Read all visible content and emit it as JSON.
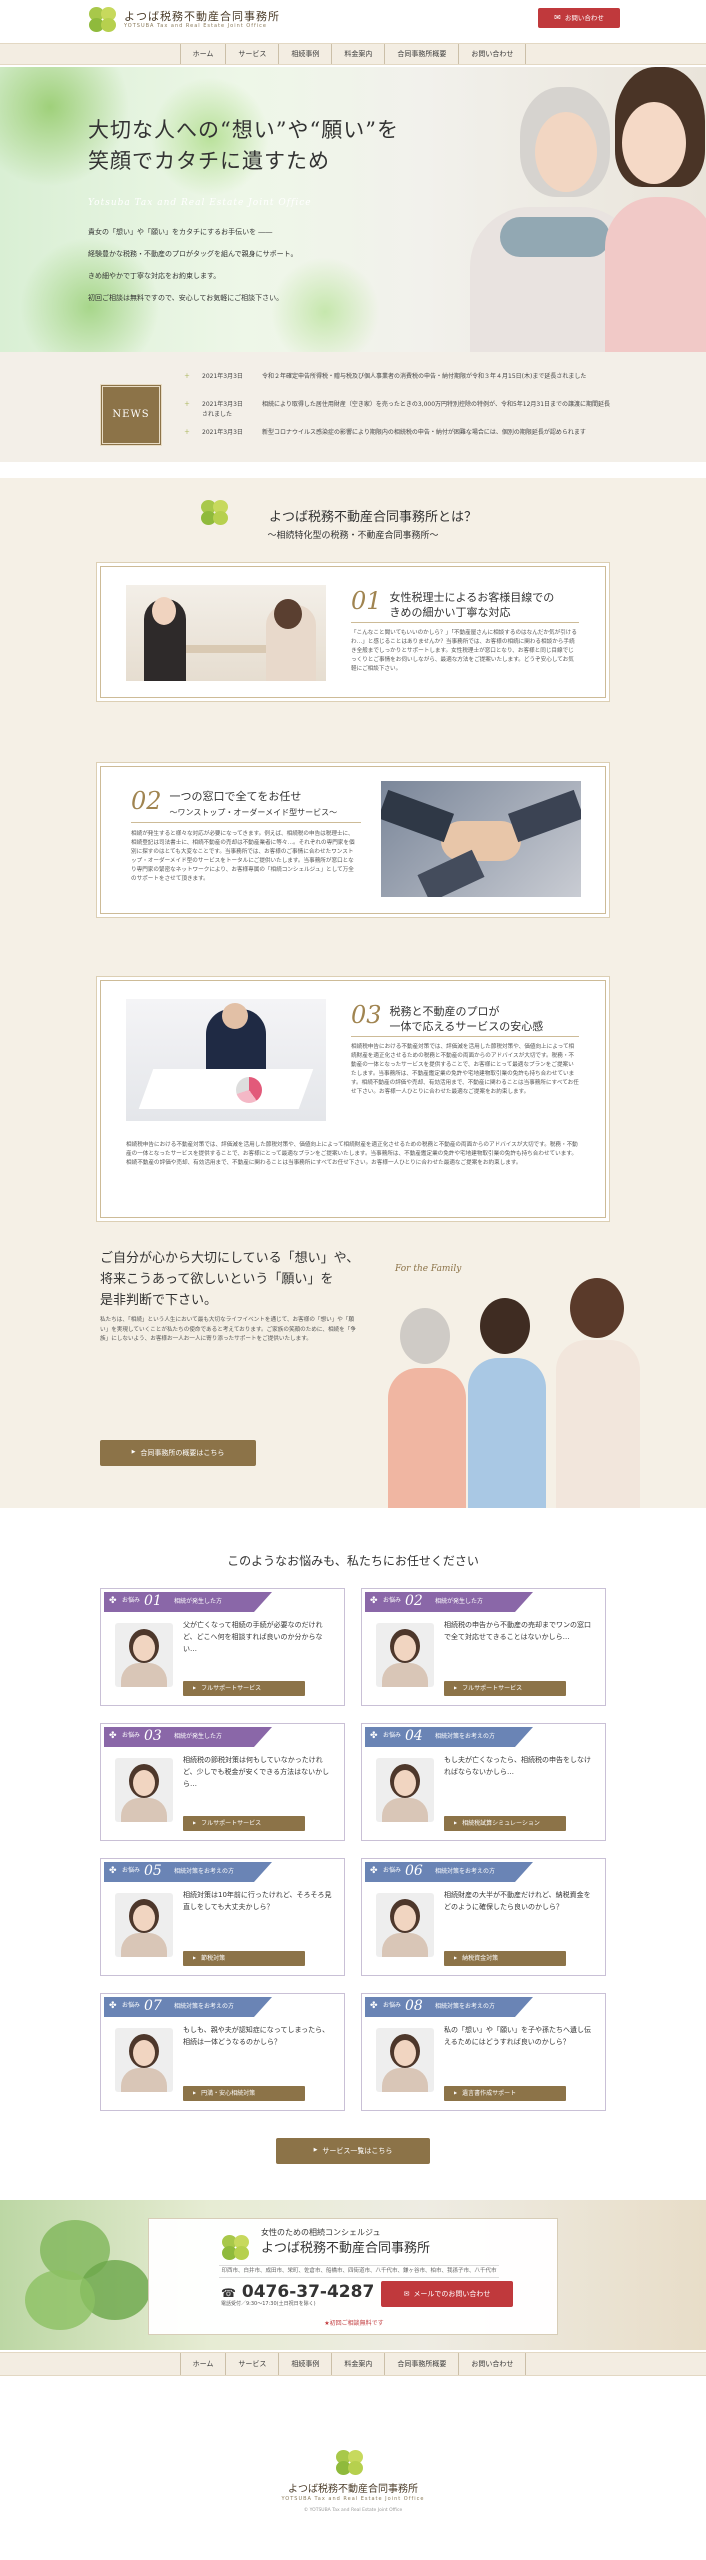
{
  "header": {
    "logo_title": "よつば税務不動産合同事務所",
    "logo_sub": "YOTSUBA Tax and Real Estate Joint Office",
    "contact_btn": "お問い合わせ"
  },
  "nav": [
    "ホーム",
    "サービス",
    "相続事例",
    "料金案内",
    "合同事務所概要",
    "お問い合わせ"
  ],
  "hero": {
    "title_line1": "大切な人への“想い”や“願い”を",
    "title_line2": "笑顔でカタチに遺すため",
    "en": "Yotsuba Tax and Real Estate Joint Office",
    "line1": "貴女の「想い」や「願い」をカタチにするお手伝いを ――",
    "line2": "経験豊かな税務・不動産のプロがタッグを組んで親身にサポート。",
    "line3": "きめ細やかで丁寧な対応をお約束します。",
    "line4": "初回ご相談は無料ですので、安心してお気軽にご相談下さい。"
  },
  "news": {
    "label": "NEWS",
    "items": [
      {
        "date": "2021年3月3日",
        "text": "令和２年確定申告所得税・贈与税及び個人事業者の消費税の申告・納付期限が令和３年４月15日(木)まで延長されました"
      },
      {
        "date": "2021年3月3日",
        "text": "相続により取得した居住用財産（空き家）を売ったときの3,000万円特別控除の特例が、令和5年12月31日までの譲渡に期間延長されました"
      },
      {
        "date": "2021年3月3日",
        "text": "新型コロナウイルス感染症の影響により期限内の相続税の申告・納付が困難な場合には、個別の期限延長が認められます"
      }
    ]
  },
  "about": {
    "title": "よつば税務不動産合同事務所とは？",
    "subtitle": "〜相続特化型の税務・不動産合同事務所〜",
    "cards": [
      {
        "num": "01",
        "heading1": "女性税理士によるお客様目線での",
        "heading2": "きめの細かい丁寧な対応",
        "text": "「こんなこと聞いてもいいのかしら？」「不動産屋さんに相談するのはなんだか気が引けるわ…」と感じることはありませんか？当事務所では、お客様の相続に関わる相談から手続き全般までしっかりとサポートします。女性税理士が窓口となり、お客様と同じ目線でじっくりとご事情をお伺いしながら、最適な方法をご提案いたします。どうぞ安心してお気軽にご相談下さい。"
      },
      {
        "num": "02",
        "heading1": "一つの窓口で全てをお任せ",
        "heading2": "〜ワンストップ・オーダーメイド型サービス〜",
        "text": "相続が発生すると様々な対応が必要になってきます。例えば、相続税の申告は税理士に、相続登記は司法書士に、相続不動産の売却は不動産業者に等々…。それぞれの専門家を個別に探すのはとても大変なことです。当事務所では、お客様のご事情に合わせたワンストップ・オーダーメイド型のサービスをトータルにご提供いたします。当事務所が窓口となり専門家の緊密なネットワークにより、お客様専属の「相続コンシェルジュ」として万全のサポートをさせて頂きます。"
      },
      {
        "num": "03",
        "heading1": "税務と不動産のプロが",
        "heading2": "一体で応えるサービスの安心感",
        "text": "相続税申告における不動産対策では、評価減を活用した節税対策や、価値向上によって相続財産を適正化させるための税務と不動産の両面からのアドバイスが大切です。税務・不動産の一体となったサービスを提供することで、お客様にとって最適なプランをご提案いたします。当事務所は、不動産鑑定業の免許や宅地建物取引業の免許も持ち合わせています。相続不動産の評価や売却、有効活用まで、不動産に関わることは当事務所にすべてお任せ下さい。お客様一人ひとりに合わせた最適なご提案をお約束します。"
      }
    ],
    "feel_title1": "ご自分が心から大切にしている「想い」や、",
    "feel_title2": "将来こうあって欲しいという「願い」を",
    "feel_title3": "是非判断で下さい。",
    "feel_text": "私たちは、「相続」という人生において最も大切なライフイベントを通じて、お客様の「想い」や「願い」を実現していくことが私たちの使命であると考えております。ご家族の笑顔のために、相続を「争族」にしないよう、お客様お一人お一人に寄り添ったサポートをご提供いたします。",
    "feel_en": "For the Family",
    "feel_btn": "合同事務所の概要はこちら"
  },
  "worries": {
    "title": "このようなお悩みも、私たちにお任せください",
    "prefix": "お悩み",
    "cards": [
      {
        "n": "01",
        "cat": "相続が発生した方",
        "text": "父が亡くなって相続の手続が必要なのだけれど、どこへ何を相談すれば良いのか分からない…",
        "btn": "フルサポートサービス",
        "color": "#8a67a8"
      },
      {
        "n": "02",
        "cat": "相続が発生した方",
        "text": "相続税の申告から不動産の売却までワンの窓口で全て対応せてきることはないかしら…",
        "btn": "フルサポートサービス",
        "color": "#8a67a8"
      },
      {
        "n": "03",
        "cat": "相続が発生した方",
        "text": "相続税の節税対策は何もしていなかったけれど、少しでも税金が安くできる方法はないかしら…",
        "btn": "フルサポートサービス",
        "color": "#8a67a8"
      },
      {
        "n": "04",
        "cat": "相続対策をお考えの方",
        "text": "もし夫が亡くなったら、相続税の申告をしなければならないかしら…",
        "btn": "相続税試算シミュレーション",
        "color": "#6a84b5"
      },
      {
        "n": "05",
        "cat": "相続対策をお考えの方",
        "text": "相続対策は10年前に行ったけれど、そろそろ見直しをしても大丈夫かしら？",
        "btn": "節税対策",
        "color": "#6a84b5"
      },
      {
        "n": "06",
        "cat": "相続対策をお考えの方",
        "text": "相続財産の大半が不動産だけれど、納税資金をどのように確保したら良いのかしら？",
        "btn": "納税資金対策",
        "color": "#6a84b5"
      },
      {
        "n": "07",
        "cat": "相続対策をお考えの方",
        "text": "もしも、親や夫が認知症になってしまったら、相続は一体どうなるのかしら？",
        "btn": "円満・安心相続対策",
        "color": "#6a84b5"
      },
      {
        "n": "08",
        "cat": "相続対策をお考えの方",
        "text": "私の「想い」や「願い」を子や孫たちへ遺し伝えるためにはどうすれば良いのかしら？",
        "btn": "遺言書作成サポート",
        "color": "#6a84b5"
      }
    ],
    "more_btn": "サービス一覧はこちら"
  },
  "concierge": {
    "tagline": "女性のための相続コンシェルジュ",
    "name": "よつば税務不動産合同事務所",
    "areas": "印西市、白井市、成田市、栄町、佐倉市、船橋市、四街道市、八千代市、鎌ヶ谷市、柏市、我孫子市、八千代市",
    "phone": "0476-37-4287",
    "hours": "電話受付／9:30〜17:30(土日祝日を除く)",
    "mail_btn": "メールでのお問い合わせ",
    "free": "★初回ご相談無料です"
  },
  "footer": {
    "name": "よつば税務不動産合同事務所",
    "sub": "YOTSUBA Tax and Real Estate Joint Office",
    "copyright": "© YOTSUBA Tax and Real Estate Joint Office"
  },
  "colors": {
    "brown": "#8c7348",
    "red": "#c0393c",
    "purple": "#8a67a8",
    "blue": "#6a84b5",
    "beige": "#f5f0e6"
  }
}
